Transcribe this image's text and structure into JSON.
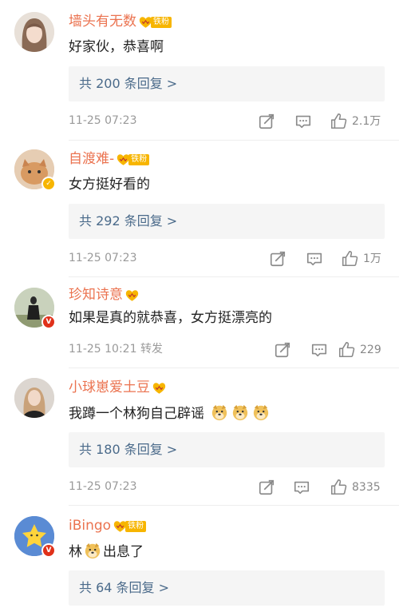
{
  "comments": [
    {
      "username": "墙头有无数",
      "fan_label": "铁粉",
      "text": "好家伙，恭喜啊",
      "replies": "共 200 条回复 >",
      "time": "11-25 07:23",
      "likes": "2.1万"
    },
    {
      "username": "自渡难-",
      "fan_label": "铁粉",
      "text": "女方挺好看的",
      "replies": "共 292 条回复 >",
      "time": "11-25 07:23",
      "likes": "1万"
    },
    {
      "username": "珍知诗意",
      "text": "如果是真的就恭喜，女方挺漂亮的",
      "time": "11-25 10:21",
      "forward": "转发",
      "likes": "229"
    },
    {
      "username": "小球崽爱土豆",
      "text": "我蹲一个林狗自己辟谣",
      "replies": "共 180 条回复 >",
      "time": "11-25 07:23",
      "likes": "8335"
    },
    {
      "username": "iBingo",
      "fan_label": "铁粉",
      "text_before": "林",
      "text_after": "出息了",
      "replies": "共 64 条回复 >"
    }
  ],
  "colors": {
    "username": "#eb7350",
    "reply_link": "#4a6a8a",
    "reply_box": "#f5f5f5",
    "meta": "#9a9a9a",
    "fan_badge": "#f7b500",
    "verified_gold": "#f7b500",
    "verified_red": "#e0311a"
  },
  "icons": {
    "share": "share-icon",
    "comment": "comment-icon",
    "like": "thumbs-up-icon",
    "emoji": "dog-emoji-icon"
  }
}
